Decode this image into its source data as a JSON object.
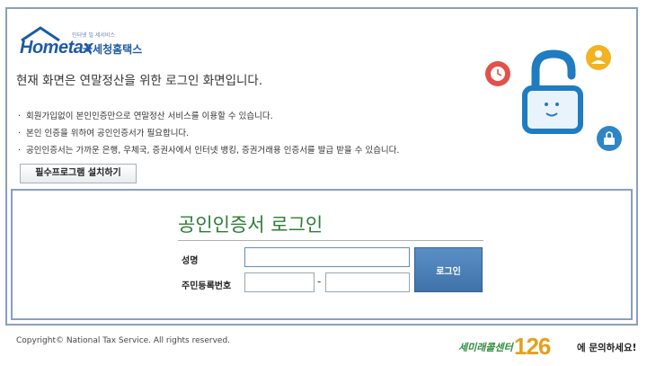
{
  "branding": {
    "logo_text": "Hometax",
    "logo_korean": "국세청홈택스",
    "logo_tagline": "인터넷 빌 세서비스"
  },
  "intro": {
    "headline": "현재 화면은 연말정산을 위한 로그인 화면입니다.",
    "bullets": [
      "회원가입없이 본인인증만으로 연말정산 서비스를 이용할 수 있습니다.",
      "본인 인증을 위하여 공인인증서가 필요합니다.",
      "공인인증서는 가까운 은행, 우체국, 증권사에서 인터넷 뱅킹, 증권거래용 인증서를 발급 받을 수 있습니다."
    ],
    "install_button": "필수프로그램 설치하기"
  },
  "login": {
    "title": "공인인증서 로그인",
    "name_label": "성명",
    "id_label": "주민등록번호",
    "name_value": "",
    "id_front_value": "",
    "id_back_value": "",
    "separator": "-",
    "login_button": "로그인"
  },
  "footer": {
    "copyright": "Copyright© National Tax Service.  All rights reserved.",
    "callcenter_prefix": "세미래콜센터",
    "callcenter_number": "126",
    "callcenter_suffix": "에 문의하세요!"
  },
  "colors": {
    "frame_border": "#8aa0bd",
    "brand_blue": "#1c5aa6",
    "title_green": "#2f7c37",
    "login_button": "#4a7fb8",
    "callcenter_orange": "#e3a01c"
  },
  "icons": [
    "house-roof-icon",
    "padlock-icon",
    "clock-icon",
    "person-icon",
    "lock-badge-icon"
  ]
}
